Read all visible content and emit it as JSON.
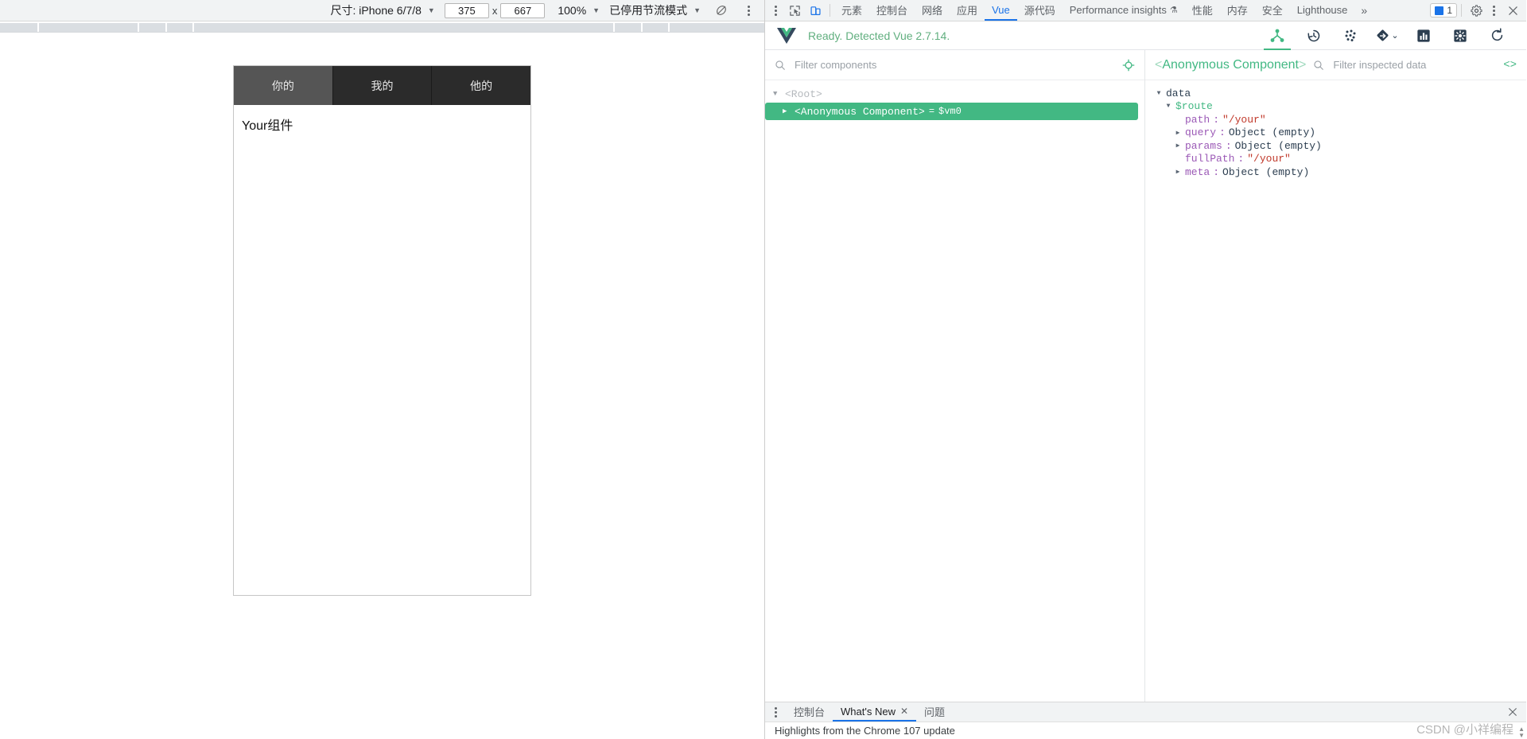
{
  "device_toolbar": {
    "size_label": "尺寸: iPhone 6/7/8",
    "width_value": "375",
    "x_label": "x",
    "height_value": "667",
    "zoom_label": "100%",
    "throttle_label": "已停用节流模式",
    "rotate_icon": "rotate-icon",
    "more_icon": "more-options-icon"
  },
  "page": {
    "tabs": [
      {
        "label": "你的",
        "active": true
      },
      {
        "label": "我的",
        "active": false
      },
      {
        "label": "他的",
        "active": false
      }
    ],
    "content": "Your组件"
  },
  "devtools": {
    "inspect_icon": "inspect-element-icon",
    "device_toggle_icon": "device-toolbar-icon",
    "tabs": [
      {
        "label": "元素",
        "selected": false
      },
      {
        "label": "控制台",
        "selected": false
      },
      {
        "label": "网络",
        "selected": false
      },
      {
        "label": "应用",
        "selected": false
      },
      {
        "label": "Vue",
        "selected": true
      },
      {
        "label": "源代码",
        "selected": false
      },
      {
        "label": "Performance insights",
        "selected": false,
        "beaker": "⚗"
      },
      {
        "label": "性能",
        "selected": false
      },
      {
        "label": "内存",
        "selected": false
      },
      {
        "label": "安全",
        "selected": false
      },
      {
        "label": "Lighthouse",
        "selected": false
      }
    ],
    "more_tabs_label": "»",
    "issues_count": "1",
    "settings_icon": "gear-icon",
    "more_icon": "more-options-icon",
    "close_icon": "close-icon"
  },
  "vue": {
    "logo": "vue-logo",
    "status": "Ready. Detected Vue 2.7.14.",
    "toolbar": [
      {
        "name": "components-tree-icon",
        "selected": true
      },
      {
        "name": "timeline-history-icon",
        "selected": false
      },
      {
        "name": "vuex-dots-icon",
        "selected": false
      },
      {
        "name": "routes-icon",
        "selected": false,
        "chevron": "⌄"
      },
      {
        "name": "performance-bars-icon",
        "selected": false
      },
      {
        "name": "settings-box-icon",
        "selected": false
      },
      {
        "name": "refresh-icon",
        "selected": false
      }
    ],
    "filter": {
      "placeholder": "Filter components",
      "search_icon": "search-icon",
      "target_icon": "select-component-target-icon"
    },
    "tree": [
      {
        "arrow": "▼",
        "label": "<Root>",
        "selected": false,
        "indent": 0
      },
      {
        "arrow": "▶",
        "label": "<Anonymous Component>",
        "vm": "$vm0",
        "selected": true,
        "indent": 1
      }
    ],
    "inspector": {
      "component_name": "Anonymous Component",
      "filter_placeholder": "Filter inspected data",
      "search_icon": "search-icon",
      "open-in-editor_icon": "code-brackets-icon",
      "rows": [
        {
          "twisty": "▼",
          "indent": 0,
          "key": "data",
          "key_style": "plain"
        },
        {
          "twisty": "▼",
          "indent": 1,
          "key": "$route",
          "key_style": "route"
        },
        {
          "twisty": "",
          "indent": 2,
          "key": "path",
          "sep": ":",
          "value": "\"/your\"",
          "value_style": "str"
        },
        {
          "twisty": "▶",
          "indent": 2,
          "key": "query",
          "sep": ":",
          "value": "Object (empty)",
          "value_style": "obj"
        },
        {
          "twisty": "▶",
          "indent": 2,
          "key": "params",
          "sep": ":",
          "value": "Object (empty)",
          "value_style": "obj"
        },
        {
          "twisty": "",
          "indent": 2,
          "key": "fullPath",
          "sep": ":",
          "value": "\"/your\"",
          "value_style": "str"
        },
        {
          "twisty": "▶",
          "indent": 2,
          "key": "meta",
          "sep": ":",
          "value": "Object (empty)",
          "value_style": "obj"
        }
      ]
    }
  },
  "drawer": {
    "tabs": [
      {
        "label": "控制台",
        "selected": false,
        "closable": false
      },
      {
        "label": "What's New",
        "selected": true,
        "closable": true
      },
      {
        "label": "问题",
        "selected": false,
        "closable": false
      }
    ],
    "close_icon": "close-icon",
    "content": "Highlights from the Chrome 107 update"
  },
  "watermark": "CSDN @小祥编程",
  "colors": {
    "vue_green": "#42b883",
    "chrome_blue": "#1a73e8",
    "toolbar_bg": "#f1f3f4",
    "string_red": "#c0392b",
    "key_purple": "#9b59b6"
  }
}
